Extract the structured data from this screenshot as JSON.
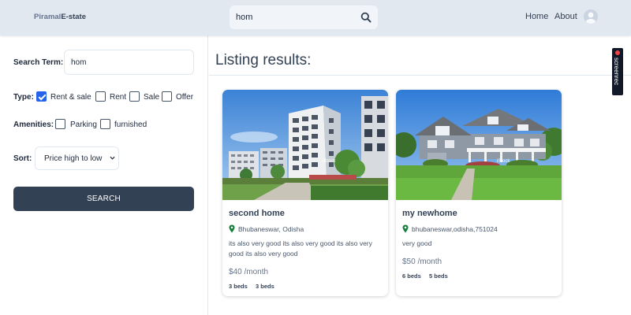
{
  "header": {
    "logo_part1": "Piramal",
    "logo_part2": "E-state",
    "search_value": "hom",
    "nav_home": "Home",
    "nav_about": "About"
  },
  "sidebar": {
    "search_term_label": "Search Term:",
    "search_term_value": "hom",
    "type_label": "Type:",
    "type_options": [
      {
        "label": "Rent & sale",
        "checked": true
      },
      {
        "label": "Rent",
        "checked": false
      },
      {
        "label": "Sale",
        "checked": false
      },
      {
        "label": "Offer",
        "checked": false
      }
    ],
    "amenities_label": "Amenities:",
    "amenity_options": [
      {
        "label": "Parking",
        "checked": false
      },
      {
        "label": "furnished",
        "checked": false
      }
    ],
    "sort_label": "Sort:",
    "sort_value": "Price high to low",
    "search_button": "SEARCH"
  },
  "main": {
    "title": "Listing results:",
    "listings": [
      {
        "name": "second home",
        "location": "Bhubaneswar, Odisha",
        "description": "its also very good its also very good its also very good its also very good",
        "price": "$40 /month",
        "beds": "3 beds",
        "baths": "3 beds",
        "image_watermark": "iStock"
      },
      {
        "name": "my newhome",
        "location": "bhubaneswar,odisha,751024",
        "description": "very good",
        "price": "$50 /month",
        "beds": "6 beds",
        "baths": "5 beds",
        "image_watermark": "iStock"
      }
    ]
  },
  "overlay": {
    "recorder_label": "screenrec"
  },
  "colors": {
    "header_bg": "#e2e8f0",
    "button_bg": "#334155",
    "checkbox_checked": "#2563eb",
    "location_pin": "#15803d"
  }
}
